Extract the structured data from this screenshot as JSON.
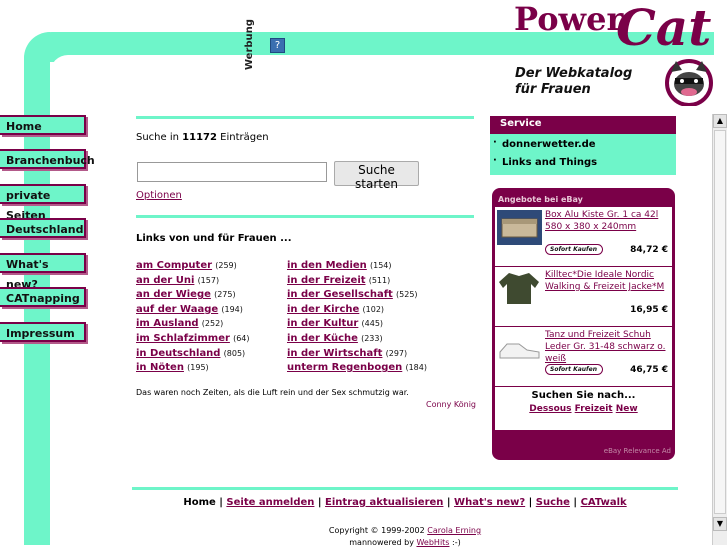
{
  "logo": {
    "title": "Power",
    "cat": "Cat",
    "subtitle_line1": "Der Webkatalog",
    "subtitle_line2": "für Frauen"
  },
  "ad": {
    "label": "Werbung",
    "help": "?"
  },
  "nav": [
    "Home",
    "Branchenbuch",
    "private Seiten",
    "Deutschland",
    "What's new?",
    "CATnapping",
    "Impressum"
  ],
  "search": {
    "prefix": "Suche in ",
    "count": "11172",
    "suffix": " Einträgen",
    "input_value": "",
    "button": "Suche starten",
    "options": "Optionen"
  },
  "links": {
    "title": "Links von und für Frauen ...",
    "left": [
      {
        "label": "am Computer",
        "count": "(259)"
      },
      {
        "label": "an der Uni",
        "count": "(157)"
      },
      {
        "label": "an der Wiege",
        "count": "(275)"
      },
      {
        "label": "auf der Waage",
        "count": "(194)"
      },
      {
        "label": "im Ausland",
        "count": "(252)"
      },
      {
        "label": "im Schlafzimmer",
        "count": "(64)"
      },
      {
        "label": "in Deutschland",
        "count": "(805)"
      },
      {
        "label": "in Nöten",
        "count": "(195)"
      }
    ],
    "right": [
      {
        "label": "in den Medien",
        "count": "(154)"
      },
      {
        "label": "in der Freizeit",
        "count": "(511)"
      },
      {
        "label": "in der Gesellschaft",
        "count": "(525)"
      },
      {
        "label": "in der Kirche",
        "count": "(102)"
      },
      {
        "label": "in der Kultur",
        "count": "(445)"
      },
      {
        "label": "in der Küche",
        "count": "(233)"
      },
      {
        "label": "in der Wirtschaft",
        "count": "(297)"
      },
      {
        "label": "unterm Regenbogen",
        "count": "(184)"
      }
    ]
  },
  "quote": "Das waren noch Zeiten, als die Luft rein und der Sex schmutzig war.",
  "quote_author": "Conny König",
  "service": {
    "title": "Service",
    "items": [
      "donnerwetter.de",
      "Links and Things"
    ]
  },
  "ebay": {
    "title": "Angebote bei eBay",
    "sofort": "Sofort Kaufen",
    "items": [
      {
        "title": "Box Alu Kiste Gr. 1 ca 42l 580 x 380 x 240mm",
        "price": "84,72 €"
      },
      {
        "title": "Killtec*Die Ideale Nordic Walking & Freizeit Jacke*M",
        "price": "16,95 €"
      },
      {
        "title": "Tanz und Freizeit Schuh Leder Gr. 31-48 schwarz o. weiß",
        "price": "46,75 €"
      }
    ],
    "search_title": "Suchen Sie nach...",
    "search_links": [
      "Dessous",
      "Freizeit",
      "New"
    ],
    "footer": "eBay Relevance Ad"
  },
  "footer": {
    "nav": [
      "Home",
      "Seite anmelden",
      "Eintrag aktualisieren",
      "What's new?",
      "Suche",
      "CATwalk"
    ],
    "separator": " | ",
    "copyright_prefix": "Copyright © 1999-2002 ",
    "copyright_name": "Carola Erning",
    "powered_prefix": "mannowered by ",
    "powered_name": "WebHits",
    "powered_suffix": " :-)"
  },
  "colors": {
    "accent": "#6ef5c9",
    "brand": "#7a0048"
  }
}
